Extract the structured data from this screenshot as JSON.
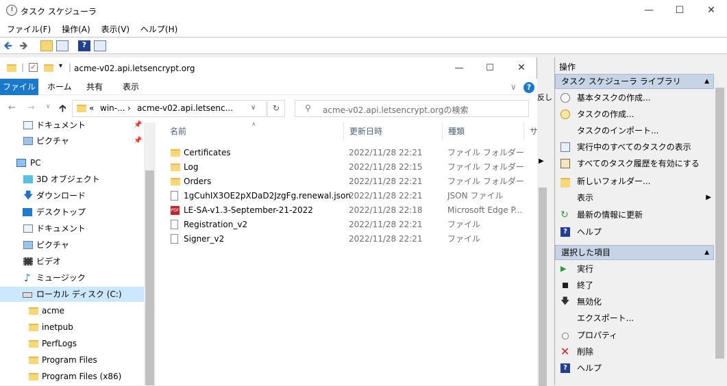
{
  "ts": {
    "title": "タスク スケジューラ",
    "menu": [
      "ファイル(F)",
      "操作(A)",
      "表示(V)",
      "ヘルプ(H)"
    ]
  },
  "explorer": {
    "title": "acme-v02.api.letsencrypt.org",
    "ribbon_tabs": [
      "ファイル",
      "ホーム",
      "共有",
      "表示"
    ],
    "address": {
      "prefix": "«",
      "seg1": "win-...",
      "seg2": "acme-v02.api.letsenc..."
    },
    "search_placeholder": "acme-v02.api.letsencrypt.orgの検索",
    "nav": [
      {
        "label": "ドキュメント",
        "icon": "document-icon",
        "pinned": true
      },
      {
        "label": "ピクチャ",
        "icon": "picture-icon",
        "pinned": true
      },
      {
        "label": "PC",
        "icon": "pc-icon"
      },
      {
        "label": "3D オブジェクト",
        "icon": "cube-icon"
      },
      {
        "label": "ダウンロード",
        "icon": "download-icon"
      },
      {
        "label": "デスクトップ",
        "icon": "desktop-icon"
      },
      {
        "label": "ドキュメント",
        "icon": "document-icon"
      },
      {
        "label": "ピクチャ",
        "icon": "picture-icon"
      },
      {
        "label": "ビデオ",
        "icon": "video-icon"
      },
      {
        "label": "ミュージック",
        "icon": "music-icon"
      },
      {
        "label": "ローカル ディスク (C:)",
        "icon": "drive-icon",
        "selected": true
      },
      {
        "label": "acme",
        "icon": "folder-icon"
      },
      {
        "label": "inetpub",
        "icon": "folder-icon"
      },
      {
        "label": "PerfLogs",
        "icon": "folder-icon"
      },
      {
        "label": "Program Files",
        "icon": "folder-icon"
      },
      {
        "label": "Program Files (x86)",
        "icon": "folder-icon"
      }
    ],
    "columns": {
      "name": "名前",
      "date": "更新日時",
      "type": "種類",
      "size": "サ"
    },
    "files": [
      {
        "name": "Certificates",
        "date": "2022/11/28 22:21",
        "type": "ファイル フォルダー",
        "icon": "folder-icon"
      },
      {
        "name": "Log",
        "date": "2022/11/28 22:15",
        "type": "ファイル フォルダー",
        "icon": "folder-icon"
      },
      {
        "name": "Orders",
        "date": "2022/11/28 22:21",
        "type": "ファイル フォルダー",
        "icon": "folder-icon"
      },
      {
        "name": "1gCuhIX3OE2pXDaD2JzgFg.renewal.json",
        "date": "2022/11/28 22:21",
        "type": "JSON ファイル",
        "icon": "file-icon"
      },
      {
        "name": "LE-SA-v1.3-September-21-2022",
        "date": "2022/11/28 22:18",
        "type": "Microsoft Edge P...",
        "icon": "pdf-icon"
      },
      {
        "name": "Registration_v2",
        "date": "2022/11/28 22:21",
        "type": "ファイル",
        "icon": "file-icon"
      },
      {
        "name": "Signer_v2",
        "date": "2022/11/28 22:21",
        "type": "ファイル",
        "icon": "file-icon"
      }
    ]
  },
  "actions": {
    "header": "操作",
    "section1": "タスク スケジューラ ライブラリ",
    "items1": [
      {
        "label": "基本タスクの作成...",
        "icon": "basic-task-icon"
      },
      {
        "label": "タスクの作成...",
        "icon": "task-icon"
      },
      {
        "label": "タスクのインポート...",
        "icon": ""
      },
      {
        "label": "実行中のすべてのタスクの表示",
        "icon": "running-tasks-icon"
      },
      {
        "label": "すべてのタスク履歴を有効にする",
        "icon": "history-icon"
      },
      {
        "label": "新しいフォルダー...",
        "icon": "new-folder-icon"
      },
      {
        "label": "表示",
        "icon": "",
        "submenu": true
      },
      {
        "label": "最新の情報に更新",
        "icon": "refresh-icon"
      },
      {
        "label": "ヘルプ",
        "icon": "help-icon"
      }
    ],
    "section2": "選択した項目",
    "items2": [
      {
        "label": "実行",
        "icon": "run-icon"
      },
      {
        "label": "終了",
        "icon": "stop-icon"
      },
      {
        "label": "無効化",
        "icon": "disable-icon"
      },
      {
        "label": "エクスポート...",
        "icon": ""
      },
      {
        "label": "プロパティ",
        "icon": "properties-icon"
      },
      {
        "label": "削除",
        "icon": "delete-icon"
      },
      {
        "label": "ヘルプ",
        "icon": "help-icon"
      }
    ]
  },
  "hidden_text": "反し"
}
